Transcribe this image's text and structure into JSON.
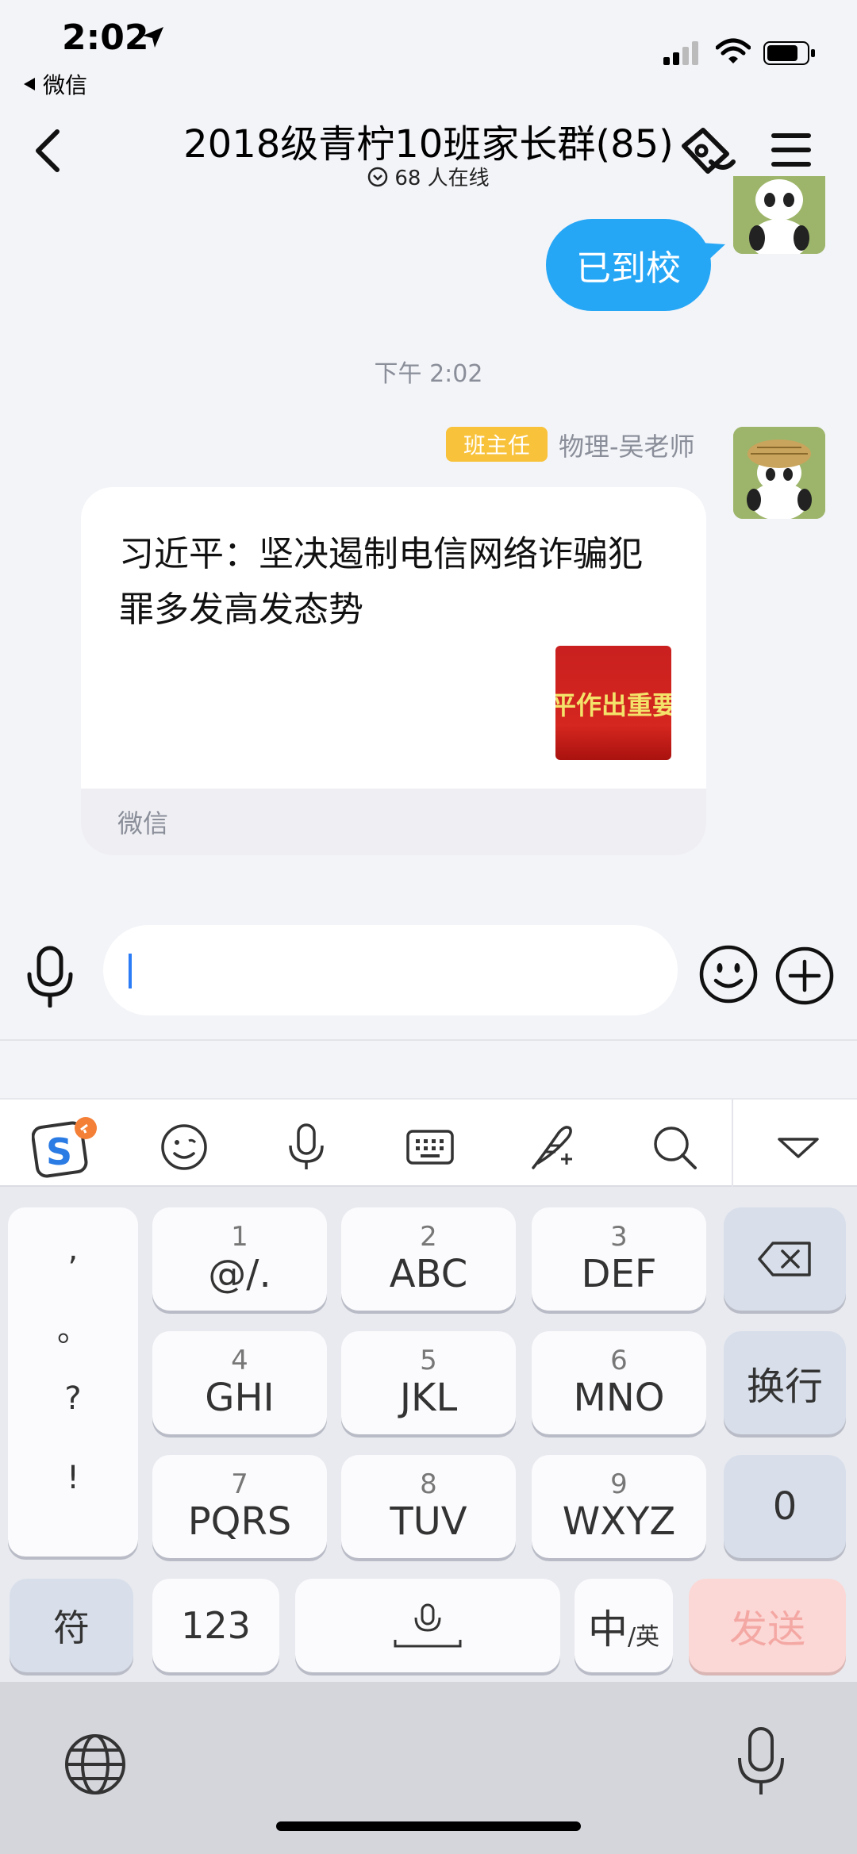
{
  "status_bar": {
    "time": "2:02",
    "back_app": "微信"
  },
  "nav": {
    "title": "2018级青柠10班家长群(85)",
    "online": "68 人在线"
  },
  "messages": {
    "own_text": "已到校",
    "timestamp": "下午 2:02",
    "sender_badge": "班主任",
    "sender_name": "物理-吴老师",
    "card_title": "习近平：坚决遏制电信网络诈骗犯罪多发高发态势",
    "card_thumb_text": "平作出重要",
    "card_source": "微信"
  },
  "input": {
    "value": ""
  },
  "keyboard": {
    "punct": [
      ",",
      "。",
      "?",
      "!"
    ],
    "keys": [
      {
        "num": "1",
        "letters": "@/."
      },
      {
        "num": "2",
        "letters": "ABC"
      },
      {
        "num": "3",
        "letters": "DEF"
      },
      {
        "num": "4",
        "letters": "GHI"
      },
      {
        "num": "5",
        "letters": "JKL"
      },
      {
        "num": "6",
        "letters": "MNO"
      },
      {
        "num": "7",
        "letters": "PQRS"
      },
      {
        "num": "8",
        "letters": "TUV"
      },
      {
        "num": "9",
        "letters": "WXYZ"
      }
    ],
    "newline": "换行",
    "zero": "0",
    "symbols": "符",
    "numbers": "123",
    "lang_main": "中",
    "lang_sub": "/英",
    "send": "发送"
  },
  "toolbar_icons": [
    "sogou-logo-icon",
    "emoji-icon",
    "voice-icon",
    "keyboard-icon",
    "handwriting-icon",
    "search-icon",
    "collapse-icon"
  ],
  "colors": {
    "accent_blue": "#26a7f6",
    "badge_yellow": "#f8c23a",
    "send_disabled": "#fbd8d6"
  }
}
